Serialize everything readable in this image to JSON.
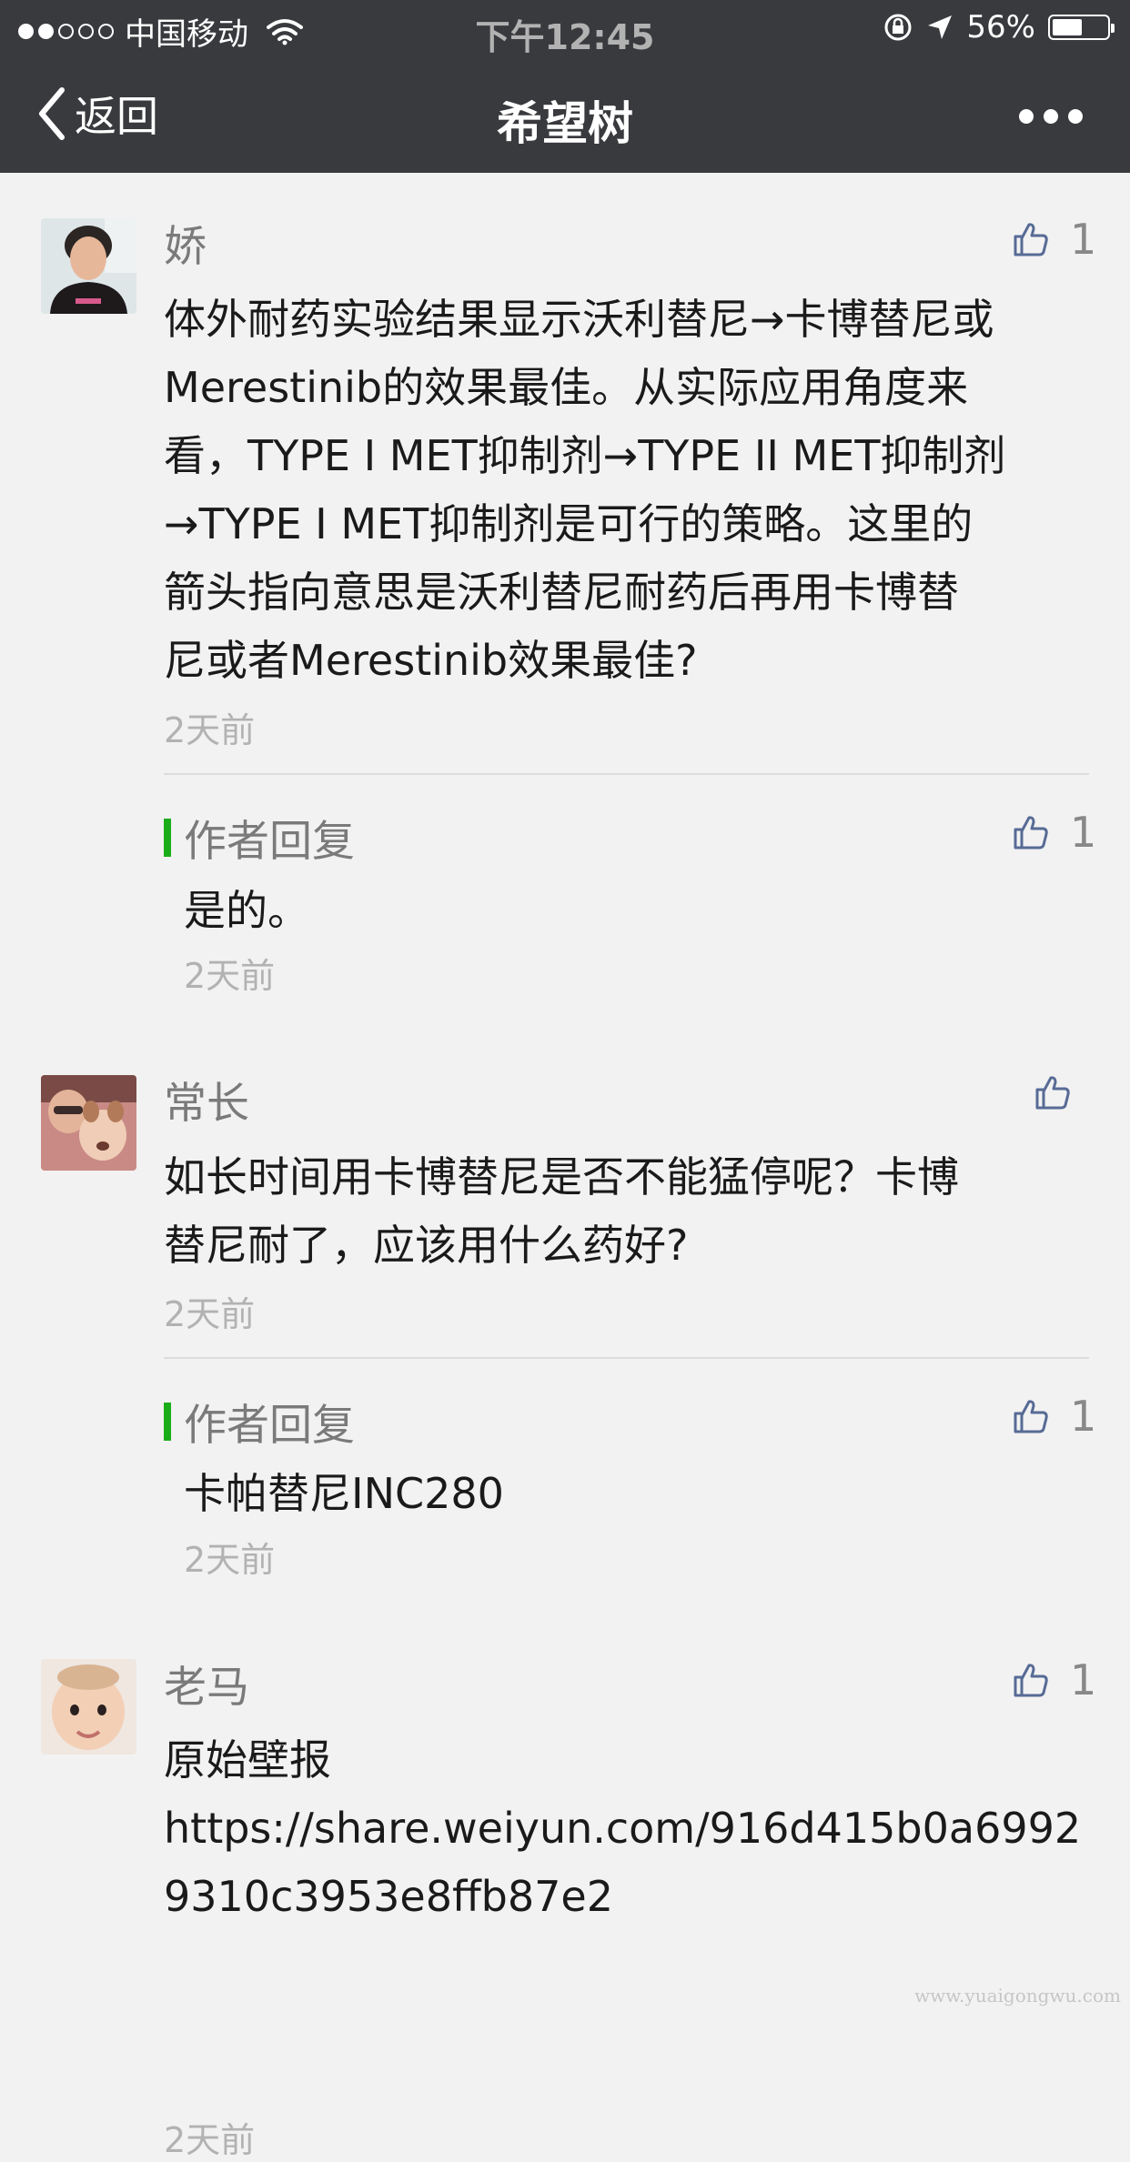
{
  "status_bar": {
    "carrier": "中国移动",
    "time": "下午12:45",
    "battery_text": "56%",
    "battery_level": 0.56,
    "signal_bars_filled": 2,
    "signal_bars_total": 5
  },
  "nav": {
    "back_label": "返回",
    "title": "希望树"
  },
  "comments": [
    {
      "name": "娇",
      "likes": "1",
      "text_lines": [
        "体外耐药实验结果显示沃利替尼→卡博替尼或",
        "Merestinib的效果最佳。从实际应用角度来",
        "看，TYPE I MET抑制剂→TYPE II MET抑制剂",
        "→TYPE I MET抑制剂是可行的策略。这里的",
        "箭头指向意思是沃利替尼耐药后再用卡博替",
        "尼或者Merestinib效果最佳?"
      ],
      "time": "2天前",
      "reply": {
        "label": "作者回复",
        "likes": "1",
        "text": "是的。",
        "time": "2天前"
      }
    },
    {
      "name": "常长",
      "likes": "",
      "text_lines": [
        "如长时间用卡博替尼是否不能猛停呢？卡博",
        "替尼耐了，应该用什么药好?"
      ],
      "time": "2天前",
      "reply": {
        "label": "作者回复",
        "likes": "1",
        "text": "卡帕替尼INC280",
        "time": "2天前"
      }
    },
    {
      "name": "老马",
      "likes": "1",
      "text_lines": [
        "原始壁报",
        "https://share.weiyun.com/916d415b0a6992",
        "9310c3953e8ffb87e2"
      ],
      "time": "2天前"
    }
  ],
  "icons": {
    "back": "chevron-left-icon",
    "more": "more-dots-icon",
    "like": "thumbs-up-icon",
    "wifi": "wifi-icon",
    "location": "location-arrow-icon",
    "lock": "rotation-lock-icon"
  },
  "colors": {
    "nav_bg": "#393a3e",
    "page_bg": "#f2f2f2",
    "reply_accent": "#1aad19",
    "like_icon": "#576b95"
  },
  "watermark": "www.yuaigongwu.com"
}
